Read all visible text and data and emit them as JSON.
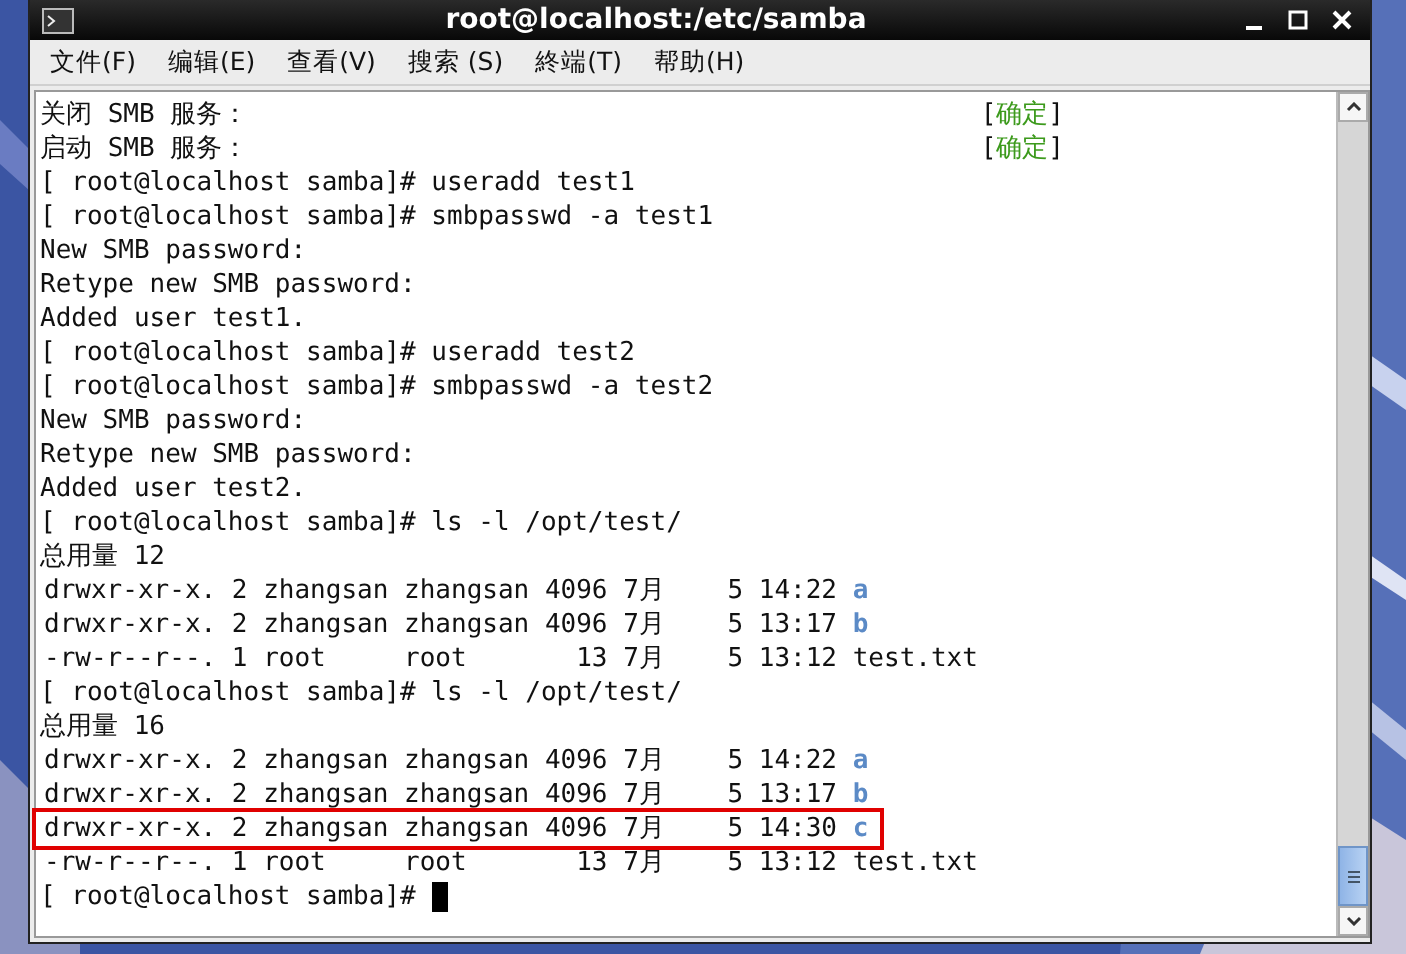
{
  "window": {
    "title": "root@localhost:/etc/samba",
    "controls": [
      {
        "kind": "minimize"
      },
      {
        "kind": "maximize"
      },
      {
        "kind": "close"
      }
    ]
  },
  "menu": [
    "文件(F)",
    "编辑(E)",
    "查看(V)",
    "搜索 (S)",
    "終端(T)",
    "帮助(H)"
  ],
  "terminal": {
    "lines": [
      {
        "kind": "status",
        "text": "关闭 SMB 服务：",
        "open": "[",
        "result": "确定",
        "close": "]"
      },
      {
        "kind": "status",
        "text": "启动 SMB 服务：",
        "open": "[",
        "result": "确定",
        "close": "]"
      },
      {
        "kind": "text",
        "text": "[ root@localhost samba]# useradd test1"
      },
      {
        "kind": "text",
        "text": "[ root@localhost samba]# smbpasswd -a test1"
      },
      {
        "kind": "text",
        "text": "New SMB password:"
      },
      {
        "kind": "text",
        "text": "Retype new SMB password:"
      },
      {
        "kind": "text",
        "text": "Added user test1."
      },
      {
        "kind": "text",
        "text": "[ root@localhost samba]# useradd test2"
      },
      {
        "kind": "text",
        "text": "[ root@localhost samba]# smbpasswd -a test2"
      },
      {
        "kind": "text",
        "text": "New SMB password:"
      },
      {
        "kind": "text",
        "text": "Retype new SMB password:"
      },
      {
        "kind": "text",
        "text": "Added user test2."
      },
      {
        "kind": "text",
        "text": "[ root@localhost samba]# ls -l /opt/test/"
      },
      {
        "kind": "text",
        "text": "总用量 12"
      },
      {
        "kind": "listing",
        "text": "drwxr-xr-x. 2 zhangsan zhangsan 4096 7月    5 14:22",
        "name": "a",
        "is_dir": true,
        "highlighted": false
      },
      {
        "kind": "listing",
        "text": "drwxr-xr-x. 2 zhangsan zhangsan 4096 7月    5 13:17",
        "name": "b",
        "is_dir": true,
        "highlighted": false
      },
      {
        "kind": "listing",
        "text": "-rw-r--r--. 1 root     root       13 7月    5 13:12",
        "name": "test.txt",
        "is_dir": false,
        "highlighted": false
      },
      {
        "kind": "text",
        "text": "[ root@localhost samba]# ls -l /opt/test/"
      },
      {
        "kind": "text",
        "text": "总用量 16"
      },
      {
        "kind": "listing",
        "text": "drwxr-xr-x. 2 zhangsan zhangsan 4096 7月    5 14:22",
        "name": "a",
        "is_dir": true,
        "highlighted": false
      },
      {
        "kind": "listing",
        "text": "drwxr-xr-x. 2 zhangsan zhangsan 4096 7月    5 13:17",
        "name": "b",
        "is_dir": true,
        "highlighted": false
      },
      {
        "kind": "listing",
        "text": "drwxr-xr-x. 2 zhangsan zhangsan 4096 7月    5 14:30",
        "name": "c",
        "is_dir": true,
        "highlighted": true
      },
      {
        "kind": "listing",
        "text": "-rw-r--r--. 1 root     root       13 7月    5 13:12",
        "name": "test.txt",
        "is_dir": false,
        "highlighted": false
      },
      {
        "kind": "cursor",
        "text": "[ root@localhost samba]#"
      }
    ]
  }
}
